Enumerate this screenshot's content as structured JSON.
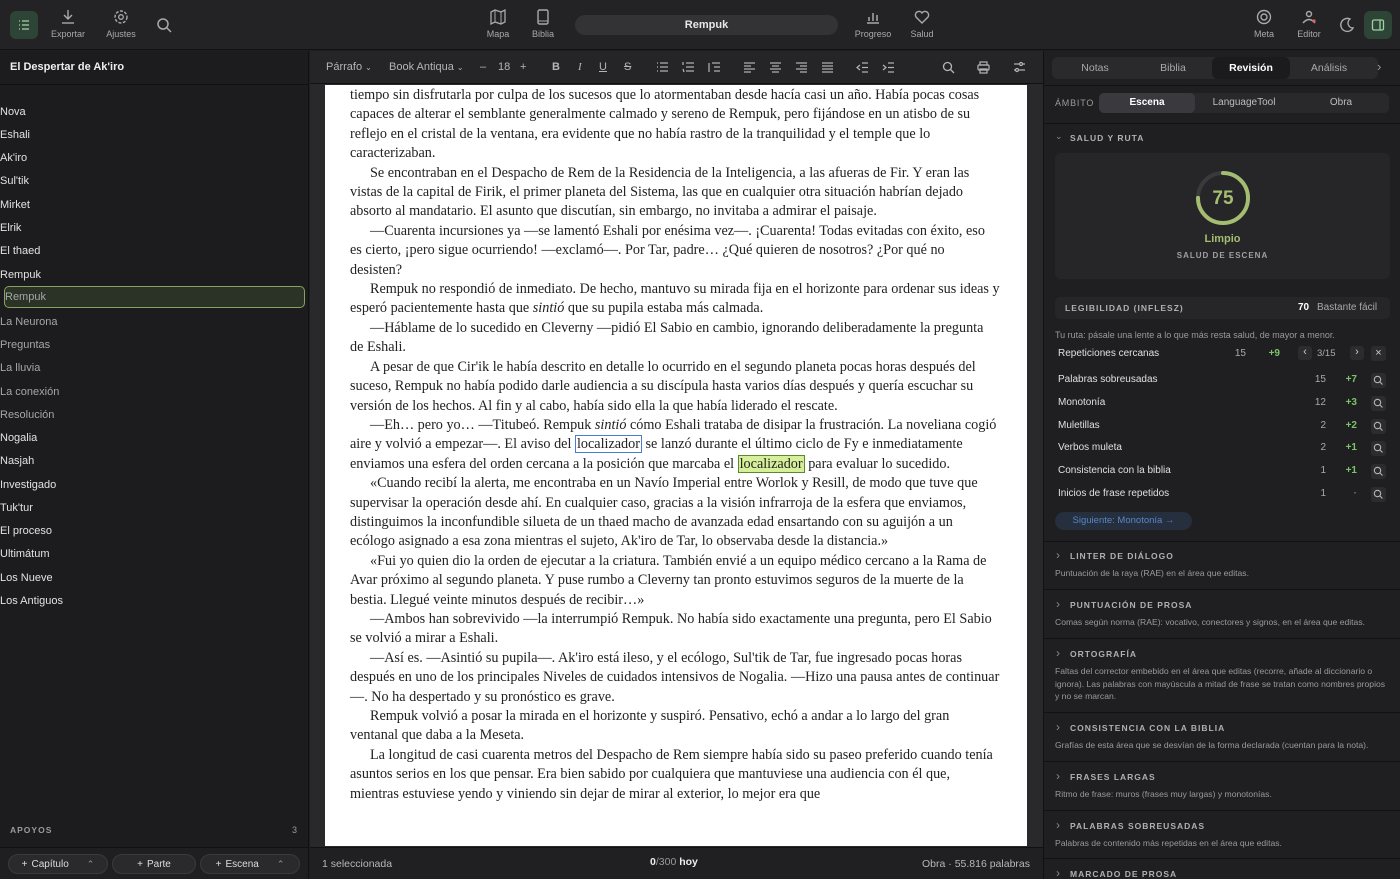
{
  "toolbar": {
    "export_label": "Exportar",
    "settings_label": "Ajustes",
    "map_label": "Mapa",
    "bible_label": "Biblia",
    "title": "Rempuk",
    "progress_label": "Progreso",
    "health_label": "Salud",
    "meta_label": "Meta",
    "editor_label": "Editor"
  },
  "sidebar": {
    "project_title": "El Despertar de Ak'iro",
    "tree": [
      {
        "label": "Nova",
        "level": 0,
        "kind": "folder",
        "state": "open"
      },
      {
        "label": "Eshali",
        "level": 1,
        "kind": "doc",
        "state": "closed"
      },
      {
        "label": "Ak'iro",
        "level": 1,
        "kind": "doc",
        "state": "closed"
      },
      {
        "label": "Sul'tik",
        "level": 1,
        "kind": "doc",
        "state": "closed"
      },
      {
        "label": "Mirket",
        "level": 1,
        "kind": "doc",
        "state": "closed"
      },
      {
        "label": "Elrik",
        "level": 1,
        "kind": "doc",
        "state": "closed"
      },
      {
        "label": "El thaed",
        "level": 1,
        "kind": "doc",
        "state": "closed"
      },
      {
        "label": "Rempuk",
        "level": 1,
        "kind": "doc",
        "state": "open"
      },
      {
        "label": "Rempuk",
        "level": 2,
        "kind": "scene",
        "state": "selected"
      },
      {
        "label": "La Neurona",
        "level": 2,
        "kind": "scene",
        "state": "none"
      },
      {
        "label": "Preguntas",
        "level": 2,
        "kind": "scene",
        "state": "none"
      },
      {
        "label": "La lluvia",
        "level": 2,
        "kind": "scene",
        "state": "none"
      },
      {
        "label": "La conexión",
        "level": 2,
        "kind": "scene",
        "state": "none"
      },
      {
        "label": "Resolución",
        "level": 2,
        "kind": "scene",
        "state": "none"
      },
      {
        "label": "Nogalia",
        "level": 1,
        "kind": "doc",
        "state": "closed"
      },
      {
        "label": "Nasjah",
        "level": 1,
        "kind": "doc",
        "state": "closed"
      },
      {
        "label": "Investigado",
        "level": 1,
        "kind": "doc",
        "state": "closed"
      },
      {
        "label": "Tuk'tur",
        "level": 1,
        "kind": "doc",
        "state": "open"
      },
      {
        "label": "El proceso",
        "level": 1,
        "kind": "doc",
        "state": "open"
      },
      {
        "label": "Ultimátum",
        "level": 1,
        "kind": "doc",
        "state": "open"
      },
      {
        "label": "Los Nueve",
        "level": 1,
        "kind": "doc",
        "state": "open"
      },
      {
        "label": "Los Antiguos",
        "level": 1,
        "kind": "doc",
        "state": "open"
      }
    ],
    "apoyos_label": "APOYOS",
    "apoyos_count": "3",
    "add_chapter": "Capítulo",
    "add_part": "Parte",
    "add_scene": "Escena"
  },
  "format_bar": {
    "style": "Párrafo",
    "font": "Book Antiqua",
    "size": "18",
    "minus": "–",
    "plus": "+"
  },
  "manuscript": {
    "p1": "tiempo sin disfrutarla por culpa de los sucesos que lo atormentaban desde hacía casi un año. Había pocas cosas capaces de alterar el semblante generalmente calmado y sereno de Rempuk, pero fijándose en un atisbo de su reflejo en el cristal de la ventana, era evidente que no había rastro de la tranquilidad y el temple que lo caracterizaban.",
    "p2": "Se encontraban en el Despacho de Rem de la Residencia de la Inteligencia, a las afueras de Fir. Y eran las vistas de la capital de Firik, el primer planeta del Sistema, las que en cualquier otra situación habrían dejado absorto al mandatario. El asunto que discutían, sin embargo, no invitaba a admirar el paisaje.",
    "p3": "—Cuarenta incursiones ya —se lamentó Eshali por enésima vez—. ¡Cuarenta! Todas evitadas con éxito, eso es cierto, ¡pero sigue ocurriendo! —exclamó—. Por Tar, padre… ¿Qué quieren de nosotros? ¿Por qué no desisten?",
    "p4a": "Rempuk no respondió de inmediato. De hecho, mantuvo su mirada fija en el horizonte para ordenar sus ideas y esperó pacientemente hasta que ",
    "p4i": "sintió",
    "p4b": " que su pupila estaba más calmada.",
    "p5": "—Háblame de lo sucedido en Cleverny —pidió El Sabio en cambio, ignorando deliberadamente la pregunta de Eshali.",
    "p6": "A pesar de que Cir'ik le había descrito en detalle lo ocurrido en el segundo planeta pocas horas después del suceso, Rempuk no había podido darle audiencia a su discípula hasta varios días después y quería escuchar su versión de los hechos. Al fin y al cabo, había sido ella la que había liderado el rescate.",
    "p7a": "—Eh… pero yo… —Titubeó. Rempuk ",
    "p7i": "sintió",
    "p7b": " cómo Eshali trataba de disipar la frustración. La noveliana cogió aire y volvió a empezar—. El aviso del ",
    "p7h1": "localizador",
    "p7c": " se lanzó durante el último ciclo de Fy e inmediatamente enviamos una esfera del orden cercana a la posición que marcaba el ",
    "p7h2": "localizador",
    "p7d": " para evaluar lo sucedido.",
    "p8": "«Cuando recibí la alerta, me encontraba en un Navío Imperial entre Worlok y Resill, de modo que tuve que supervisar la operación desde ahí. En cualquier caso, gracias a la visión infrarroja de la esfera que enviamos, distinguimos la inconfundible silueta de un thaed macho de avanzada edad ensartando con su aguijón a un ecólogo asignado a esa zona mientras el sujeto, Ak'iro de Tar, lo observaba desde la distancia.»",
    "p9": "«Fui yo quien dio la orden de ejecutar a la criatura. También envié a un equipo médico cercano a la Rama de Avar próximo al segundo planeta. Y puse rumbo a Cleverny tan pronto estuvimos seguros de la muerte de la bestia. Llegué veinte minutos después de recibir…»",
    "p10": "—Ambos han sobrevivido —la interrumpió Rempuk. No había sido exactamente una pregunta, pero El Sabio se volvió a mirar a Eshali.",
    "p11": "—Así es. —Asintió su pupila—. Ak'iro está ileso, y el ecólogo, Sul'tik de Tar, fue ingresado pocas horas después en uno de los principales Niveles de cuidados intensivos de Nogalia. —Hizo una pausa antes de continuar—. No ha despertado y su pronóstico es grave.",
    "p12": "Rempuk volvió a posar la mirada en el horizonte y suspiró. Pensativo, echó a andar a lo largo del gran ventanal que daba a la Meseta.",
    "p13": "La longitud de casi cuarenta metros del Despacho de Rem siempre había sido su paseo preferido cuando tenía asuntos serios en los que pensar. Era bien sabido por cualquiera que mantuviese una audiencia con él que, mientras estuviese yendo y viniendo sin dejar de mirar al exterior, lo mejor era que"
  },
  "status": {
    "selection": "1 seleccionada",
    "words_today_count": "0",
    "words_today_goal": "/300",
    "words_today_suffix": "hoy",
    "total": "Obra · 55.816 palabras"
  },
  "right_panel": {
    "tabs": [
      "Notas",
      "Biblia",
      "Revisión",
      "Análisis"
    ],
    "active_tab": "Revisión",
    "scope_label": "ÁMBITO",
    "scopes": [
      "Escena",
      "LanguageTool",
      "Obra"
    ],
    "active_scope": "Escena",
    "health_section": "SALUD Y RUTA",
    "health_score": "75",
    "health_fraction": 0.75,
    "health_status": "Limpio",
    "health_caption": "SALUD DE ESCENA",
    "legibility_label": "LEGIBILIDAD (INFLESZ)",
    "legibility_score": "70",
    "legibility_text": "Bastante fácil",
    "route_hint": "Tu ruta: pásale una lente a lo que más resta salud, de mayor a menor.",
    "issues": [
      {
        "label": "Repeticiones cercanas",
        "count": "15",
        "delta": "+9",
        "nav": "3/15"
      },
      {
        "label": "Palabras sobreusadas",
        "count": "15",
        "delta": "+7"
      },
      {
        "label": "Monotonía",
        "count": "12",
        "delta": "+3"
      },
      {
        "label": "Muletillas",
        "count": "2",
        "delta": "+2"
      },
      {
        "label": "Verbos muleta",
        "count": "2",
        "delta": "+1"
      },
      {
        "label": "Consistencia con la biblia",
        "count": "1",
        "delta": "+1"
      },
      {
        "label": "Inicios de frase repetidos",
        "count": "1",
        "delta": "·"
      }
    ],
    "next_label": "Siguiente: Monotonía →",
    "sections": [
      {
        "title": "LINTER DE DIÁLOGO",
        "desc": "Puntuación de la raya (RAE) en el área que editas."
      },
      {
        "title": "PUNTUACIÓN DE PROSA",
        "desc": "Comas según norma (RAE): vocativo, conectores y signos, en el área que editas."
      },
      {
        "title": "ORTOGRAFÍA",
        "desc": "Faltas del corrector embebido en el área que editas (recorre, añade al diccionario o ignora). Las palabras con mayúscula a mitad de frase se tratan como nombres propios y no se marcan."
      },
      {
        "title": "CONSISTENCIA CON LA BIBLIA",
        "desc": "Grafías de esta área que se desvían de la forma declarada (cuentan para la nota)."
      },
      {
        "title": "FRASES LARGAS",
        "desc": "Ritmo de frase: muros (frases muy largas) y monotonías."
      },
      {
        "title": "PALABRAS SOBREUSADAS",
        "desc": "Palabras de contenido más repetidas en el área que editas."
      },
      {
        "title": "MARCADO DE PROSA",
        "desc": ""
      }
    ]
  },
  "colors": {
    "accent": "#8aa060",
    "gauge": "#a5bd70",
    "positive": "#7bc36a",
    "link": "#5a86c8"
  }
}
